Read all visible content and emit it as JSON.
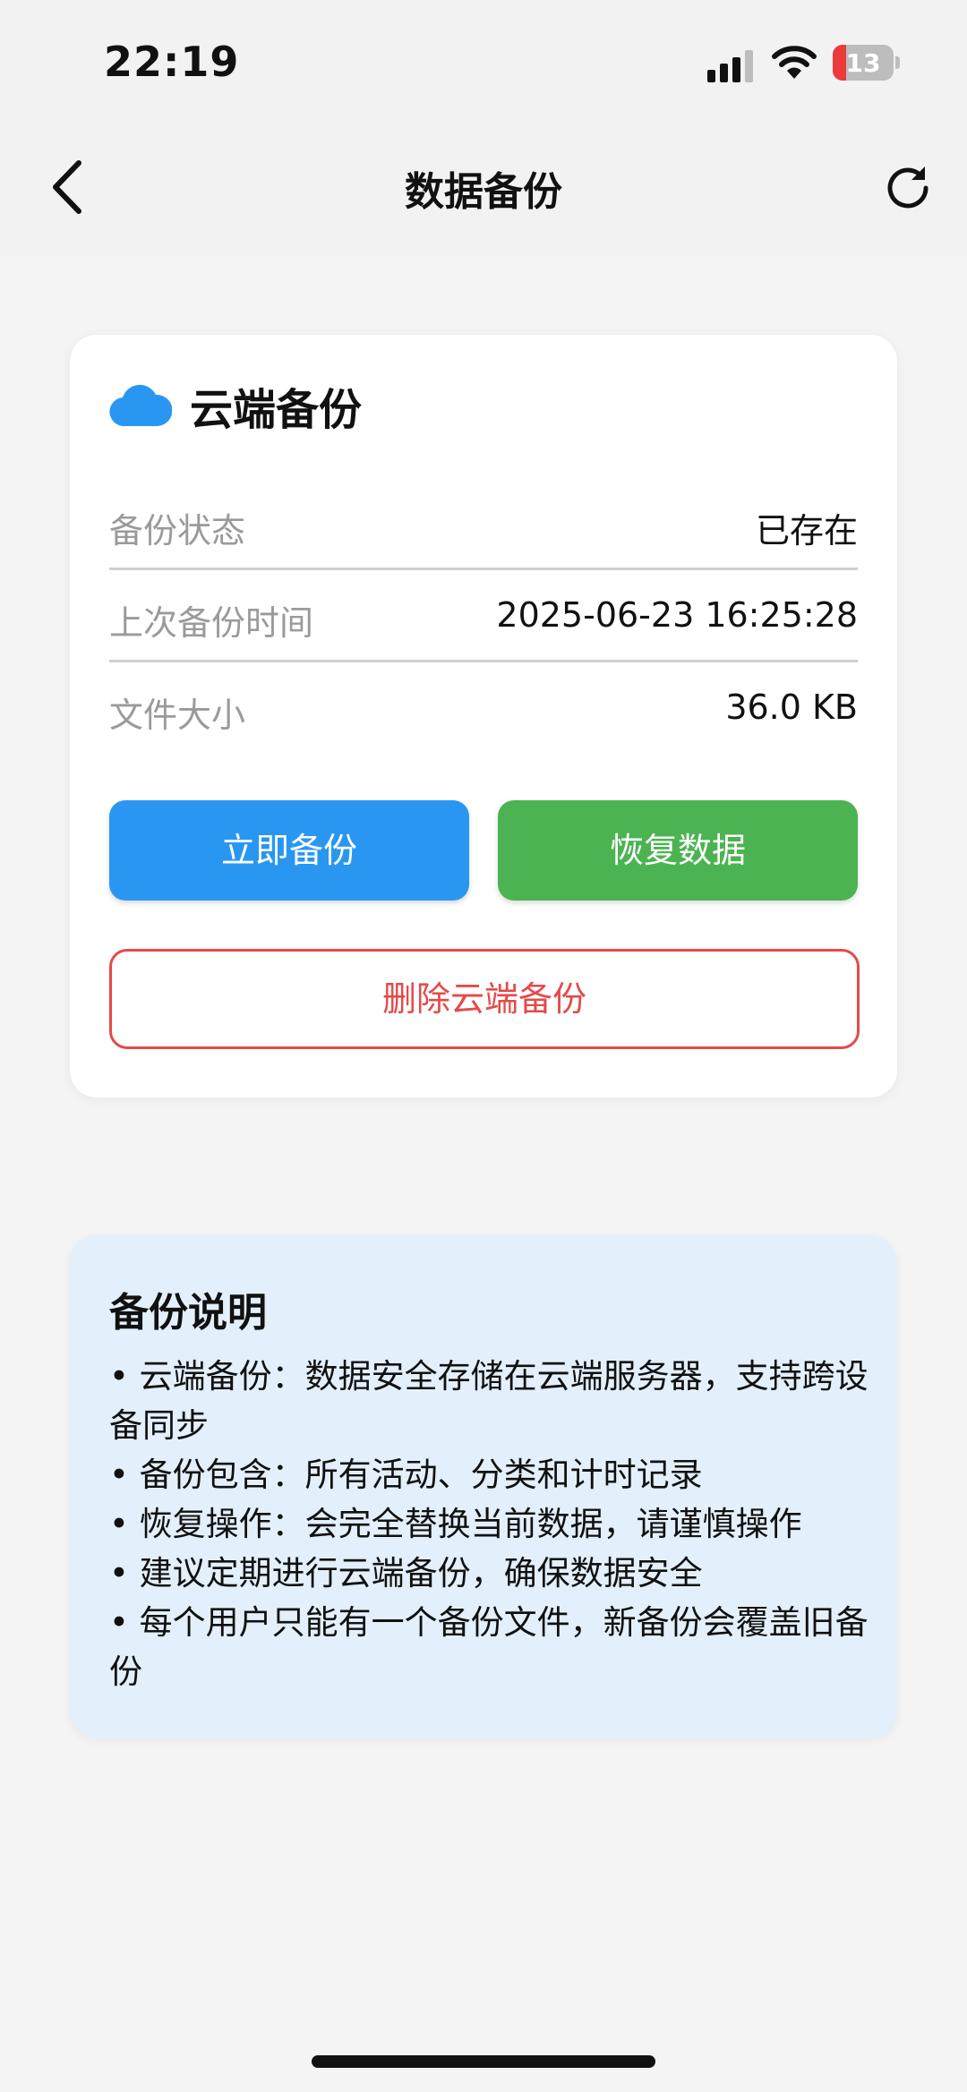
{
  "status_bar": {
    "time": "22:19",
    "battery": "13",
    "battery_level": 0.13
  },
  "nav": {
    "title": "数据备份"
  },
  "card": {
    "title": "云端备份",
    "rows": [
      {
        "label": "备份状态",
        "value": "已存在"
      },
      {
        "label": "上次备份时间",
        "value": "2025-06-23 16:25:28"
      },
      {
        "label": "文件大小",
        "value": "36.0 KB"
      }
    ],
    "backup_button": "立即备份",
    "restore_button": "恢复数据",
    "delete_button": "删除云端备份"
  },
  "info": {
    "title": "备份说明",
    "items": [
      "• 云端备份：数据安全存储在云端服务器，支持跨设备同步",
      "• 备份包含：所有活动、分类和计时记录",
      "• 恢复操作：会完全替换当前数据，请谨慎操作",
      "• 建议定期进行云端备份，确保数据安全",
      "• 每个用户只能有一个备份文件，新备份会覆盖旧备份"
    ]
  },
  "colors": {
    "primary": "#2997f2",
    "success": "#4cb352",
    "danger": "#e44a4a",
    "info_bg": "#e3f0fb"
  }
}
